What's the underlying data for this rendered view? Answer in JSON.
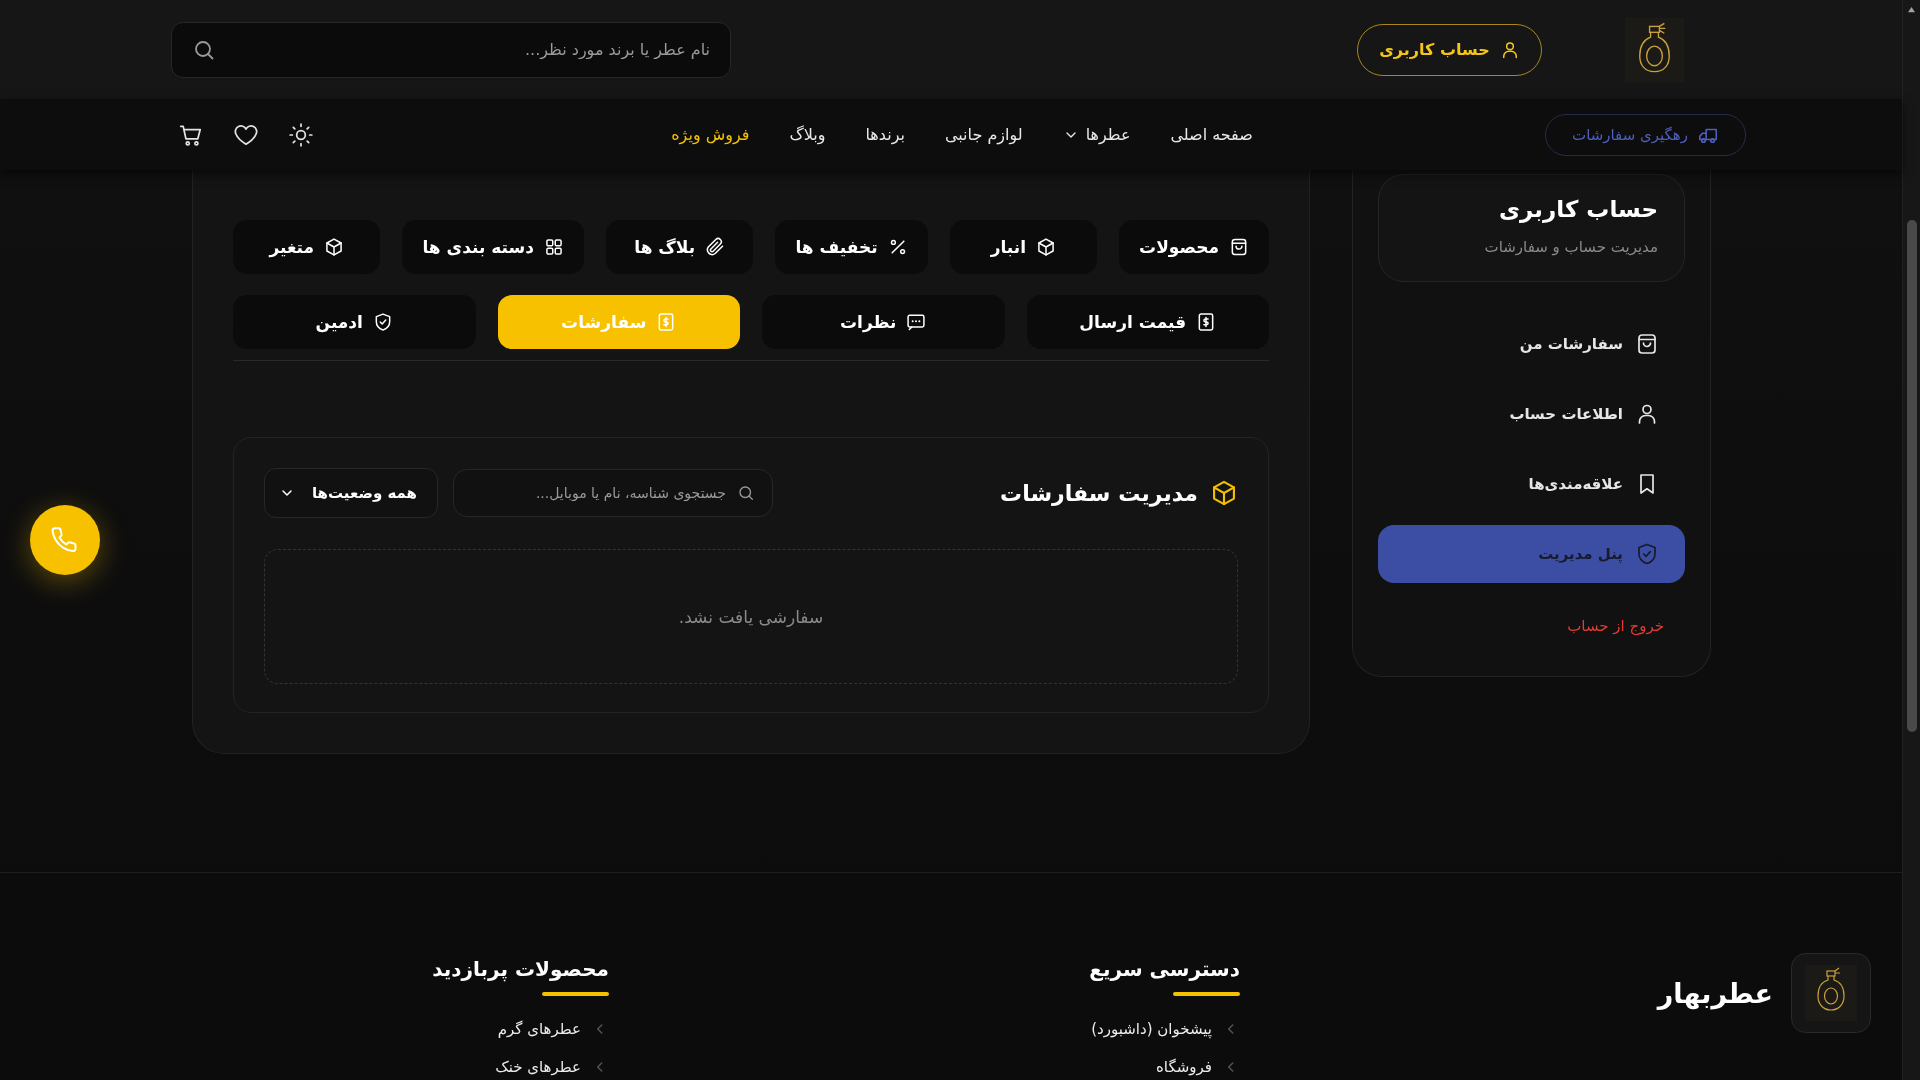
{
  "header": {
    "account_button": "حساب کاربری",
    "search": {
      "placeholder": "نام عطر یا برند مورد نظر..."
    }
  },
  "navbar": {
    "track_orders_button": "رهگیری سفارشات",
    "links": [
      {
        "label": "صفحه اصلی",
        "kind": "link"
      },
      {
        "label": "عطرها",
        "kind": "dropdown"
      },
      {
        "label": "لوازم جانبی",
        "kind": "link"
      },
      {
        "label": "برندها",
        "kind": "link"
      },
      {
        "label": "وبلاگ",
        "kind": "link"
      },
      {
        "label": "فروش ویژه",
        "kind": "highlight"
      }
    ]
  },
  "sidebar": {
    "title": "حساب کاربری",
    "subtitle": "مدیریت حساب و سفارشات",
    "items": [
      {
        "label": "سفارشات من",
        "selected": false
      },
      {
        "label": "اطلاعات حساب",
        "selected": false
      },
      {
        "label": "علاقه‌مندی‌ها",
        "selected": false
      },
      {
        "label": "پنل مدیریت",
        "selected": true
      }
    ],
    "logout": "خروج از حساب"
  },
  "admin_tab_rows": [
    [
      {
        "label": "محصولات",
        "selected": false
      },
      {
        "label": "انبار",
        "selected": false
      },
      {
        "label": "تخفیف ها",
        "selected": false
      },
      {
        "label": "بلاگ ها",
        "selected": false
      },
      {
        "label": "دسته بندی ها",
        "selected": false
      },
      {
        "label": "متغیر",
        "selected": false
      }
    ],
    [
      {
        "label": "قیمت ارسال",
        "selected": false
      },
      {
        "label": "نظرات",
        "selected": false
      },
      {
        "label": "سفارشات",
        "selected": true
      },
      {
        "label": "ادمین",
        "selected": false
      }
    ]
  ],
  "orders": {
    "title": "مدیریت سفارشات",
    "search": {
      "placeholder": "جستجوی شناسه، نام یا موبایل..."
    },
    "status_filter": "همه وضعیت‌ها",
    "empty_message": "سفارشی یافت نشد."
  },
  "footer": {
    "brand": "عطربهار",
    "columns": [
      {
        "title": "دسترسی سریع",
        "links": [
          "پیشخوان (داشبورد)",
          "فروشگاه"
        ]
      },
      {
        "title": "محصولات پربازدید",
        "links": [
          "عطرهای گرم",
          "عطرهای خنک"
        ]
      }
    ]
  }
}
